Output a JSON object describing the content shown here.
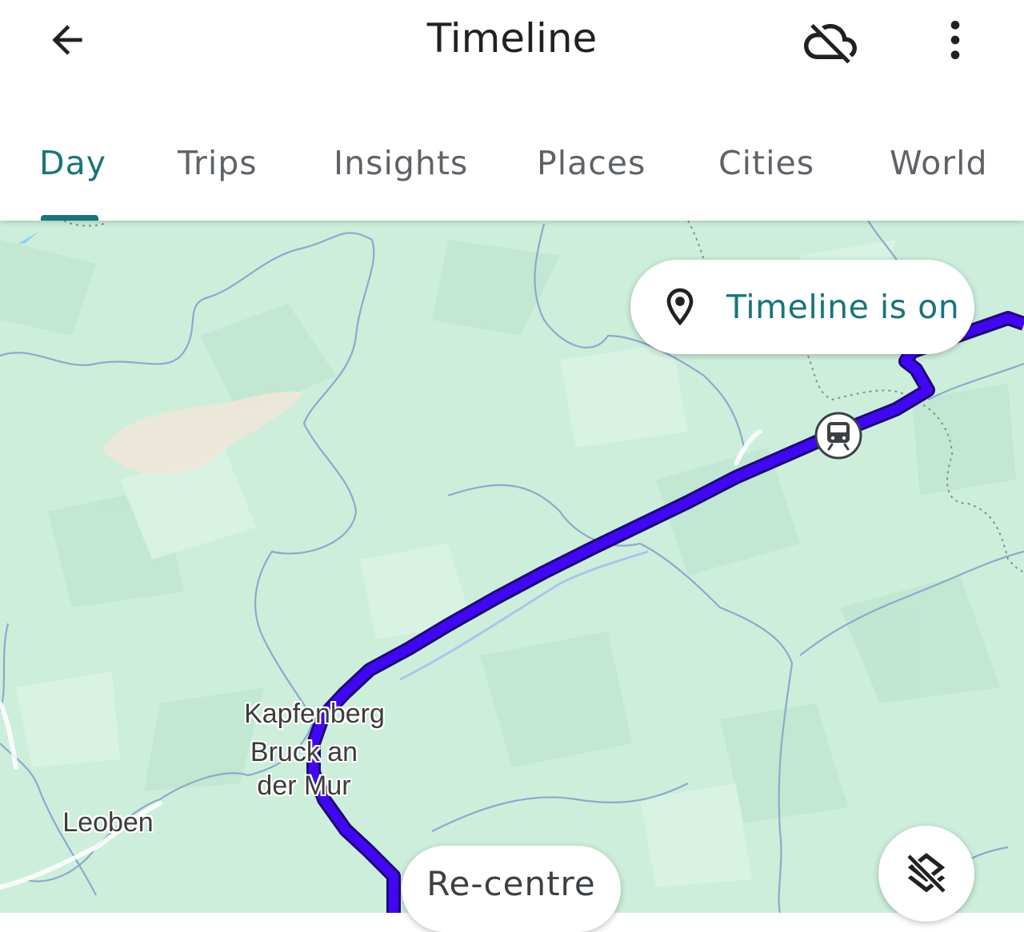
{
  "header": {
    "title": "Timeline",
    "back_icon": "arrow-back-icon",
    "sync_icon": "cloud-off-icon",
    "menu_icon": "more-vert-icon"
  },
  "tabs": [
    {
      "label": "Day",
      "active": true
    },
    {
      "label": "Trips",
      "active": false
    },
    {
      "label": "Insights",
      "active": false
    },
    {
      "label": "Places",
      "active": false
    },
    {
      "label": "Cities",
      "active": false
    },
    {
      "label": "World",
      "active": false
    }
  ],
  "map": {
    "status_chip": {
      "label": "Timeline is on",
      "icon": "location-pin-icon"
    },
    "places": [
      {
        "name": "Kapfenberg"
      },
      {
        "name": "Bruck an der Mur"
      },
      {
        "name": "Leoben"
      }
    ],
    "train_marker_icon": "train-icon",
    "route_color": "#3f07f5",
    "recentre_label": "Re-centre",
    "layers_icon": "layers-off-icon"
  },
  "colors": {
    "accent": "#16767b",
    "map_land": "#cdeedb",
    "route": "#3f07f5"
  }
}
